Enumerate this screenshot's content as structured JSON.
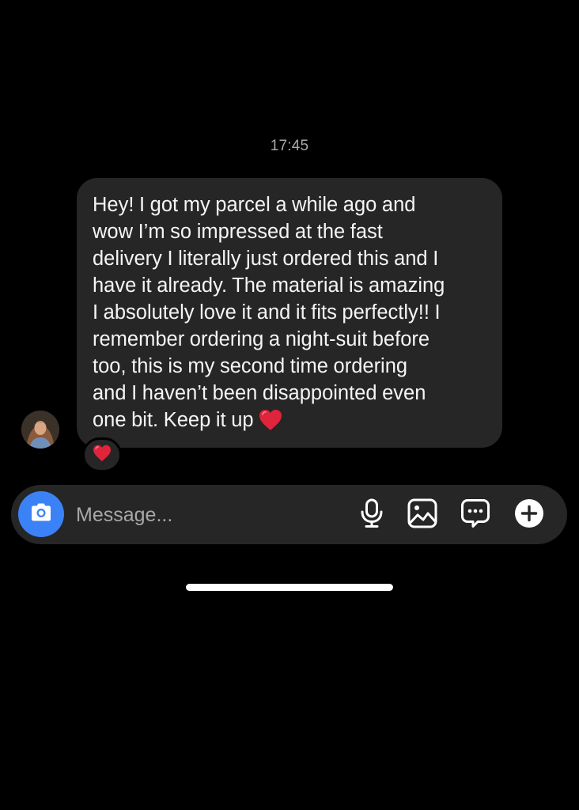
{
  "thread": {
    "timestamp": "17:45"
  },
  "message": {
    "lines": [
      "Hey! I got my parcel a while ago and",
      "wow I’m so impressed at the fast",
      "delivery I literally just ordered this and I",
      "have it already. The material is amazing",
      "I absolutely love it and it fits perfectly!! I",
      "remember ordering a night-suit before",
      "too, this is my second time ordering",
      "and I haven’t been disappointed even",
      "one bit. Keep it up"
    ],
    "trailing_emoji": "heart-emoji",
    "reaction": "heart-emoji",
    "sender_avatar": "profile-photo"
  },
  "composer": {
    "placeholder": "Message...",
    "value": "",
    "icons": [
      "camera-icon",
      "microphone-icon",
      "gallery-icon",
      "chat-bubble-icon",
      "plus-icon"
    ]
  },
  "colors": {
    "background": "#000000",
    "bubble": "#262626",
    "accent_blue": "#3b82f6",
    "heart_red": "#e0243c",
    "muted_text": "#a8a8a8"
  }
}
